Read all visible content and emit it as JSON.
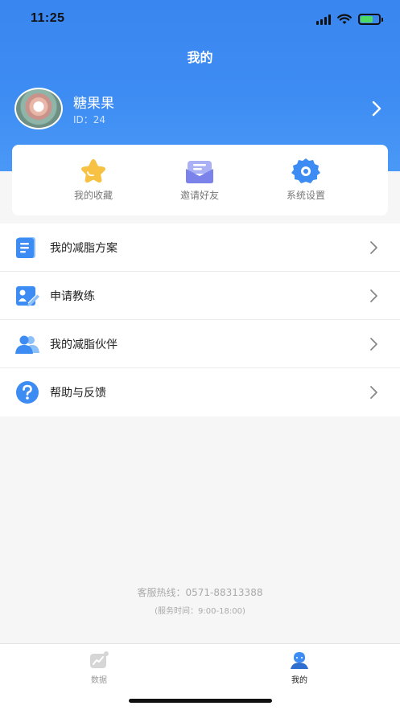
{
  "status_bar": {
    "time": "11:25"
  },
  "header": {
    "title": "我的"
  },
  "profile": {
    "name": "糖果果",
    "id_text": "ID：24"
  },
  "quick_actions": [
    {
      "label": "我的收藏",
      "icon": "star-icon"
    },
    {
      "label": "邀请好友",
      "icon": "mail-icon"
    },
    {
      "label": "系统设置",
      "icon": "gear-icon"
    }
  ],
  "menu": [
    {
      "label": "我的减脂方案",
      "icon": "document-icon"
    },
    {
      "label": "申请教练",
      "icon": "apply-icon"
    },
    {
      "label": "我的减脂伙伴",
      "icon": "users-icon"
    },
    {
      "label": "帮助与反馈",
      "icon": "help-icon"
    }
  ],
  "footer": {
    "hotline": "客服热线：0571-88313388",
    "service_time": "(服务时间：9:00-18:00)"
  },
  "tabbar": {
    "tabs": [
      {
        "label": "数据",
        "active": false
      },
      {
        "label": "我的",
        "active": true
      }
    ]
  },
  "colors": {
    "primary": "#3d8cf3",
    "star": "#f7c244",
    "mail": "#7b83ea",
    "tab_inactive": "#999999",
    "tab_active": "#222222"
  }
}
